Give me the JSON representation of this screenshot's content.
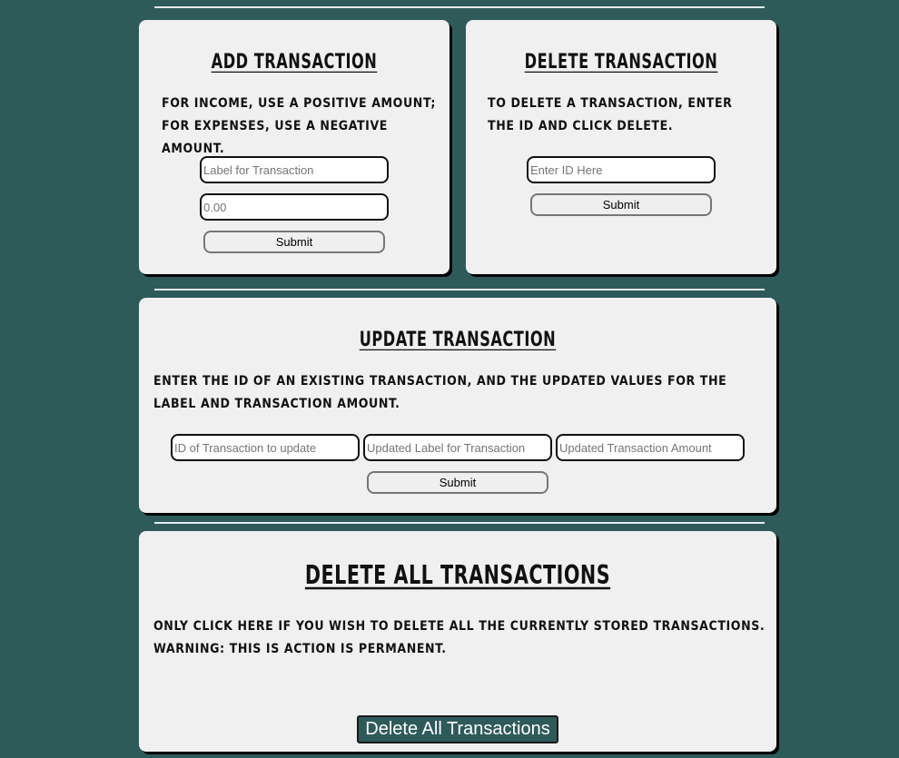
{
  "add": {
    "title": "Add Transaction",
    "desc": "For income, use a positive amount; for expenses, use a negative amount.",
    "label_placeholder": "Label for Transaction",
    "amount_placeholder": "0.00",
    "submit": "Submit"
  },
  "delete": {
    "title": "Delete Transaction",
    "desc": "To delete a transaction, enter the ID and click delete.",
    "id_placeholder": "Enter ID Here",
    "submit": "Submit"
  },
  "update": {
    "title": "Update Transaction",
    "desc": "Enter the ID of an existing transaction, and the updated values for the label and transaction amount.",
    "id_placeholder": "ID of Transaction to update",
    "label_placeholder": "Updated Label for Transaction",
    "amount_placeholder": "Updated Transaction Amount",
    "submit": "Submit"
  },
  "delete_all": {
    "title": "Delete All Transactions",
    "desc": "Only click here if you wish to delete all the currently stored transactions. Warning: This is action is permanent.",
    "button": "Delete All Transactions"
  },
  "colors": {
    "background": "#2e5a5a",
    "card": "#f0f0f0"
  }
}
